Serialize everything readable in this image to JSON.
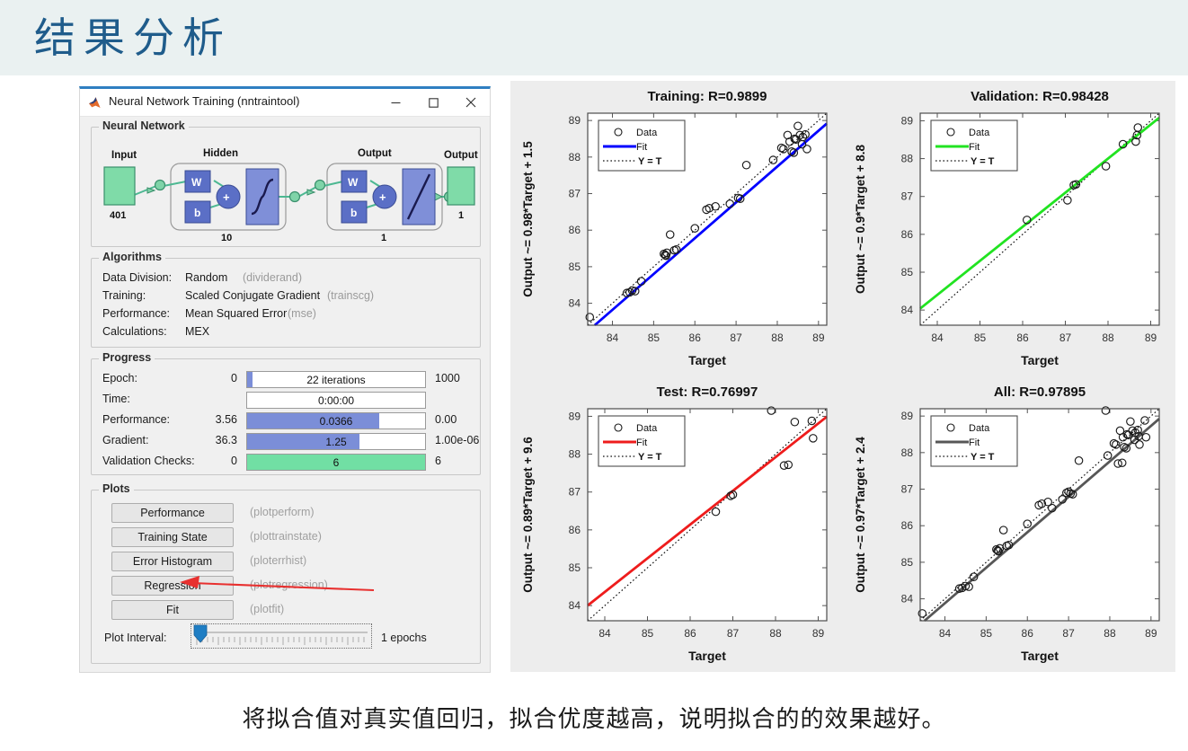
{
  "slide": {
    "title": "结果分析",
    "title_color": "#1f5c8b",
    "header_bg": "#eaf1f1",
    "caption": "将拟合值对真实值回归，拟合优度越高，说明拟合的的效果越好。"
  },
  "window": {
    "title": "Neural Network Training (nntraintool)",
    "minimize_label": "—",
    "maximize_label": "□",
    "close_label": "✕",
    "accent_color": "#2f7fc1"
  },
  "neural_network": {
    "group_label": "Neural Network",
    "input_label": "Input",
    "input_size": "401",
    "hidden_label": "Hidden",
    "hidden_size": "10",
    "output_layer_label": "Output",
    "output_size": "1",
    "output_label": "Output",
    "output_count": "1",
    "weight_label": "W",
    "bias_label": "b",
    "sum_label": "+"
  },
  "algorithms": {
    "group_label": "Algorithms",
    "rows": [
      {
        "key": "Data Division:",
        "value": "Random",
        "fn": "(dividerand)"
      },
      {
        "key": "Training:",
        "value": "Scaled Conjugate Gradient",
        "fn": "(trainscg)"
      },
      {
        "key": "Performance:",
        "value": "Mean Squared Error",
        "fn": "(mse)"
      },
      {
        "key": "Calculations:",
        "value": "MEX",
        "fn": ""
      }
    ]
  },
  "progress": {
    "group_label": "Progress",
    "bar_blue": "#7b8ed8",
    "bar_green": "#71dfa4",
    "rows": [
      {
        "label": "Epoch:",
        "left": "0",
        "bar": "22 iterations",
        "right": "1000",
        "pct": 3,
        "color": "#7b8ed8"
      },
      {
        "label": "Time:",
        "left": "",
        "bar": "0:00:00",
        "right": "",
        "pct": 0,
        "color": "#7b8ed8"
      },
      {
        "label": "Performance:",
        "left": "3.56",
        "bar": "0.0366",
        "right": "0.00",
        "pct": 74,
        "color": "#7b8ed8"
      },
      {
        "label": "Gradient:",
        "left": "36.3",
        "bar": "1.25",
        "right": "1.00e-06",
        "pct": 63,
        "color": "#7b8ed8"
      },
      {
        "label": "Validation Checks:",
        "left": "0",
        "bar": "6",
        "right": "6",
        "pct": 100,
        "color": "#71dfa4"
      }
    ]
  },
  "plots": {
    "group_label": "Plots",
    "buttons": [
      {
        "label": "Performance",
        "fn": "(plotperform)"
      },
      {
        "label": "Training State",
        "fn": "(plottrainstate)"
      },
      {
        "label": "Error Histogram",
        "fn": "(ploterrhist)"
      },
      {
        "label": "Regression",
        "fn": "(plotregression)"
      },
      {
        "label": "Fit",
        "fn": "(plotfit)"
      }
    ],
    "interval_label": "Plot Interval:",
    "interval_value": "1 epochs"
  },
  "annotation": {
    "arrow_color": "#e8302f",
    "points_to": "Regression"
  },
  "chart_data": [
    {
      "type": "scatter",
      "id": "training",
      "title": "Training: R=0.9899",
      "xlabel": "Target",
      "ylabel": "Output ~= 0.98*Target + 1.5",
      "xlim": [
        83.4,
        89.2
      ],
      "ylim": [
        83.4,
        89.2
      ],
      "xticks": [
        84,
        85,
        86,
        87,
        88,
        89
      ],
      "yticks": [
        84,
        85,
        86,
        87,
        88,
        89
      ],
      "fit_color": "#0000ff",
      "fit_slope": 0.98,
      "fit_intercept": 1.5,
      "legend": [
        "Data",
        "Fit",
        "Y = T"
      ],
      "legend_position": "top-left",
      "grid": false,
      "points": [
        [
          83.45,
          83.62
        ],
        [
          84.35,
          84.28
        ],
        [
          84.42,
          84.3
        ],
        [
          84.48,
          84.35
        ],
        [
          84.55,
          84.33
        ],
        [
          84.7,
          84.6
        ],
        [
          85.25,
          85.35
        ],
        [
          85.28,
          85.32
        ],
        [
          85.3,
          85.3
        ],
        [
          85.32,
          85.38
        ],
        [
          85.4,
          85.88
        ],
        [
          85.5,
          85.45
        ],
        [
          85.55,
          85.47
        ],
        [
          86.0,
          86.05
        ],
        [
          86.28,
          86.56
        ],
        [
          86.35,
          86.6
        ],
        [
          86.5,
          86.65
        ],
        [
          86.85,
          86.72
        ],
        [
          87.05,
          86.88
        ],
        [
          87.1,
          86.86
        ],
        [
          87.25,
          87.78
        ],
        [
          87.9,
          87.92
        ],
        [
          88.1,
          88.25
        ],
        [
          88.15,
          88.22
        ],
        [
          88.25,
          88.6
        ],
        [
          88.3,
          88.42
        ],
        [
          88.35,
          88.15
        ],
        [
          88.4,
          88.12
        ],
        [
          88.42,
          88.5
        ],
        [
          88.45,
          88.48
        ],
        [
          88.5,
          88.85
        ],
        [
          88.55,
          88.6
        ],
        [
          88.6,
          88.35
        ],
        [
          88.62,
          88.55
        ],
        [
          88.68,
          88.62
        ],
        [
          88.72,
          88.22
        ]
      ]
    },
    {
      "type": "scatter",
      "id": "validation",
      "title": "Validation: R=0.98428",
      "xlabel": "Target",
      "ylabel": "Output ~= 0.9*Target + 8.8",
      "xlim": [
        83.6,
        89.2
      ],
      "ylim": [
        83.6,
        89.2
      ],
      "xticks": [
        84,
        85,
        86,
        87,
        88,
        89
      ],
      "yticks": [
        84,
        85,
        86,
        87,
        88,
        89
      ],
      "fit_color": "#21e321",
      "fit_slope": 0.9,
      "fit_intercept": 8.8,
      "legend": [
        "Data",
        "Fit",
        "Y = T"
      ],
      "legend_position": "top-left",
      "grid": false,
      "points": [
        [
          86.1,
          86.38
        ],
        [
          87.05,
          86.9
        ],
        [
          87.2,
          87.3
        ],
        [
          87.25,
          87.32
        ],
        [
          87.95,
          87.8
        ],
        [
          88.35,
          88.38
        ],
        [
          88.65,
          88.45
        ],
        [
          88.68,
          88.62
        ],
        [
          88.7,
          88.82
        ]
      ]
    },
    {
      "type": "scatter",
      "id": "test",
      "title": "Test: R=0.76997",
      "xlabel": "Target",
      "ylabel": "Output ~= 0.89*Target + 9.6",
      "xlim": [
        83.6,
        89.2
      ],
      "ylim": [
        83.6,
        89.2
      ],
      "xticks": [
        84,
        85,
        86,
        87,
        88,
        89
      ],
      "yticks": [
        84,
        85,
        86,
        87,
        88,
        89
      ],
      "fit_color": "#ee1c1c",
      "fit_slope": 0.89,
      "fit_intercept": 9.6,
      "legend": [
        "Data",
        "Fit",
        "Y = T"
      ],
      "legend_position": "top-left",
      "grid": false,
      "points": [
        [
          86.6,
          86.48
        ],
        [
          86.95,
          86.9
        ],
        [
          87.0,
          86.93
        ],
        [
          87.9,
          89.15
        ],
        [
          88.2,
          87.7
        ],
        [
          88.3,
          87.72
        ],
        [
          88.45,
          88.85
        ],
        [
          88.85,
          88.88
        ],
        [
          88.88,
          88.42
        ]
      ]
    },
    {
      "type": "scatter",
      "id": "all",
      "title": "All: R=0.97895",
      "xlabel": "Target",
      "ylabel": "Output ~= 0.97*Target + 2.4",
      "xlim": [
        83.4,
        89.2
      ],
      "ylim": [
        83.4,
        89.2
      ],
      "xticks": [
        84,
        85,
        86,
        87,
        88,
        89
      ],
      "yticks": [
        84,
        85,
        86,
        87,
        88,
        89
      ],
      "fit_color": "#575757",
      "fit_slope": 0.97,
      "fit_intercept": 2.4,
      "legend": [
        "Data",
        "Fit",
        "Y = T"
      ],
      "legend_position": "top-left",
      "grid": false,
      "points": [
        [
          83.45,
          83.6
        ],
        [
          84.35,
          84.28
        ],
        [
          84.42,
          84.3
        ],
        [
          84.5,
          84.35
        ],
        [
          84.58,
          84.33
        ],
        [
          84.7,
          84.6
        ],
        [
          85.25,
          85.35
        ],
        [
          85.28,
          85.32
        ],
        [
          85.3,
          85.3
        ],
        [
          85.33,
          85.38
        ],
        [
          85.42,
          85.88
        ],
        [
          85.5,
          85.45
        ],
        [
          85.55,
          85.47
        ],
        [
          86.0,
          86.05
        ],
        [
          86.28,
          86.56
        ],
        [
          86.35,
          86.6
        ],
        [
          86.5,
          86.65
        ],
        [
          86.6,
          86.48
        ],
        [
          86.85,
          86.72
        ],
        [
          86.95,
          86.9
        ],
        [
          87.0,
          86.93
        ],
        [
          87.05,
          86.88
        ],
        [
          87.1,
          86.86
        ],
        [
          87.25,
          87.78
        ],
        [
          87.9,
          89.15
        ],
        [
          87.95,
          87.92
        ],
        [
          88.1,
          88.25
        ],
        [
          88.15,
          88.22
        ],
        [
          88.2,
          87.7
        ],
        [
          88.25,
          88.6
        ],
        [
          88.3,
          87.72
        ],
        [
          88.32,
          88.42
        ],
        [
          88.35,
          88.15
        ],
        [
          88.4,
          88.12
        ],
        [
          88.42,
          88.5
        ],
        [
          88.45,
          88.48
        ],
        [
          88.5,
          88.85
        ],
        [
          88.55,
          88.6
        ],
        [
          88.6,
          88.35
        ],
        [
          88.62,
          88.55
        ],
        [
          88.68,
          88.62
        ],
        [
          88.7,
          88.45
        ],
        [
          88.72,
          88.22
        ],
        [
          88.85,
          88.88
        ],
        [
          88.88,
          88.42
        ]
      ]
    }
  ]
}
